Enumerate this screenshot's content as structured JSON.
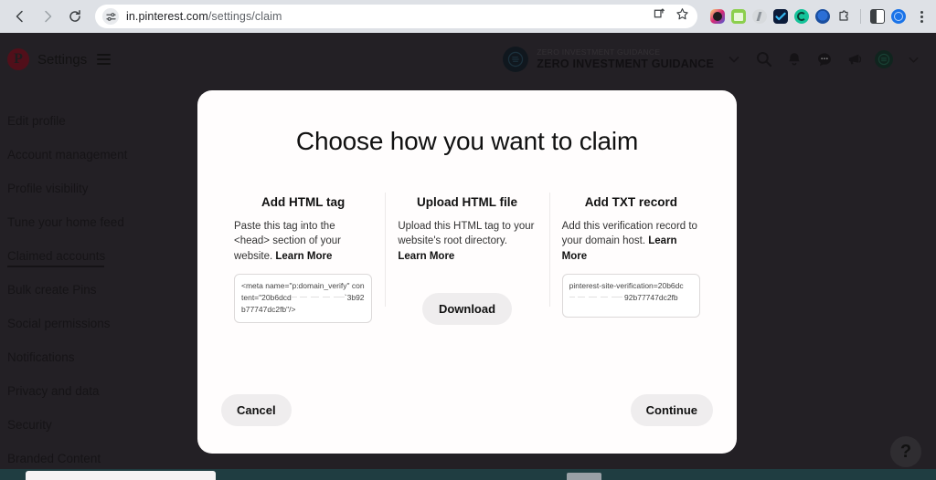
{
  "browser": {
    "back_icon": "back-arrow-icon",
    "forward_icon": "forward-arrow-icon",
    "reload_icon": "reload-icon",
    "page_info_icon": "page-info-icon",
    "url_host": "in.pinterest.com",
    "url_path": "/settings/claim",
    "install_icon": "install-app-icon",
    "bookmark_icon": "bookmark-star-icon",
    "menu_icon": "three-dot-menu-icon",
    "extensions": [
      {
        "name": "extension-instagram",
        "color": "#e4405f"
      },
      {
        "name": "extension-printer",
        "color": "#7fc241"
      },
      {
        "name": "extension-flash",
        "color": "#cfd3d7"
      },
      {
        "name": "extension-todo",
        "color": "#0b1b3a"
      },
      {
        "name": "extension-grammarly",
        "color": "#15c39a"
      },
      {
        "name": "extension-blue-dot",
        "color": "#1a73e8"
      },
      {
        "name": "extension-puzzle",
        "color": "#3c4043"
      }
    ],
    "profile_icon": "profile-avatar-icon"
  },
  "header": {
    "logo_letter": "P",
    "settings_label": "Settings",
    "menu_icon": "hamburger-menu-icon",
    "account_sub": "ZERO INVESTMENT GUIDANCE",
    "account_name": "ZERO INVESTMENT GUIDANCE",
    "chevron_icon": "chevron-down-icon",
    "search_icon": "search-icon",
    "notifications_icon": "bell-icon",
    "messages_icon": "chat-bubble-icon",
    "announcements_icon": "megaphone-icon",
    "status_icon": "status-avatar-icon",
    "profile_chevron_icon": "chevron-down-icon"
  },
  "sidebar": {
    "items": [
      {
        "label": "Edit profile",
        "selected": false
      },
      {
        "label": "Account management",
        "selected": false
      },
      {
        "label": "Profile visibility",
        "selected": false
      },
      {
        "label": "Tune your home feed",
        "selected": false
      },
      {
        "label": "Claimed accounts",
        "selected": true
      },
      {
        "label": "Bulk create Pins",
        "selected": false
      },
      {
        "label": "Social permissions",
        "selected": false
      },
      {
        "label": "Notifications",
        "selected": false
      },
      {
        "label": "Privacy and data",
        "selected": false
      },
      {
        "label": "Security",
        "selected": false
      },
      {
        "label": "Branded Content",
        "selected": false
      }
    ]
  },
  "modal": {
    "title": "Choose how you want to claim",
    "columns": [
      {
        "title": "Add HTML tag",
        "description": "Paste this tag into the <head> section of your website. ",
        "learn_more": "Learn More",
        "code_line1": "<meta name=\"p:domain_verify\"",
        "code_line2_pre": "content=\"20b6dcd",
        "code_line2_post": "`3b92",
        "code_line3": "b77747dc2fb\"/>",
        "has_code": true,
        "has_button": false
      },
      {
        "title": "Upload HTML file",
        "description": "Upload this HTML tag to your website's root directory. ",
        "learn_more": "Learn More",
        "button_label": "Download",
        "has_code": false,
        "has_button": true
      },
      {
        "title": "Add TXT record",
        "description": "Add this verification record to your domain host. ",
        "learn_more": "Learn More",
        "code_line1": "pinterest-site-",
        "code_line2_pre": "verification=20b6dc",
        "code_line2_post": "",
        "code_line3": "92b77747dc2fb",
        "has_code": true,
        "has_button": false
      }
    ],
    "cancel_label": "Cancel",
    "continue_label": "Continue"
  },
  "help": {
    "icon": "question-mark-icon",
    "label": "?"
  },
  "colors": {
    "pinterest_red": "#9c0d22",
    "modal_bg": "#fffdfd",
    "button_bg": "#efedee",
    "page_bg": "#36323a"
  }
}
